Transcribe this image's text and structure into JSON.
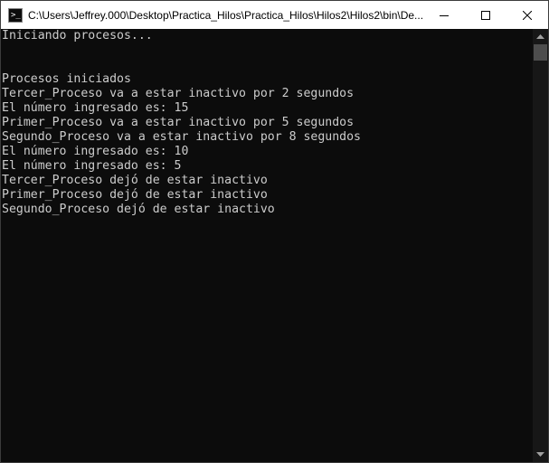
{
  "window": {
    "title": "C:\\Users\\Jeffrey.000\\Desktop\\Practica_Hilos\\Practica_Hilos\\Hilos2\\Hilos2\\bin\\De...",
    "icon": "console-app-icon",
    "icon_glyph": ">_"
  },
  "controls": {
    "minimize": "minimize-icon",
    "maximize": "maximize-icon",
    "close": "close-icon"
  },
  "console": {
    "lines": [
      "Iniciando procesos...",
      "",
      "",
      "Procesos iniciados",
      "Tercer_Proceso va a estar inactivo por 2 segundos",
      "El número ingresado es: 15",
      "Primer_Proceso va a estar inactivo por 5 segundos",
      "Segundo_Proceso va a estar inactivo por 8 segundos",
      "El número ingresado es: 10",
      "El número ingresado es: 5",
      "Tercer_Proceso dejó de estar inactivo",
      "Primer_Proceso dejó de estar inactivo",
      "Segundo_Proceso dejó de estar inactivo"
    ]
  },
  "colors": {
    "background": "#0c0c0c",
    "text": "#cccccc",
    "titlebar": "#ffffff",
    "scrollbar_track": "#171717",
    "scrollbar_thumb": "#4d4d4d"
  }
}
